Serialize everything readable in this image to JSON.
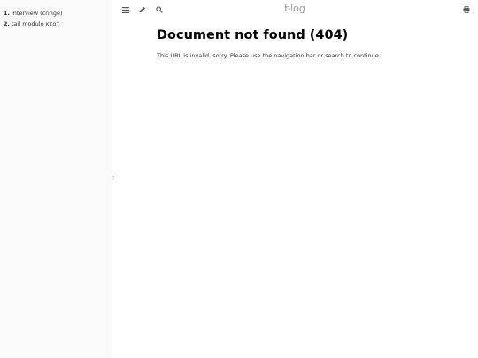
{
  "sidebar": {
    "chapters": [
      {
        "number": "1.",
        "title": "interview (cringe)"
      },
      {
        "number": "2.",
        "title": "tail modulo κτοτ"
      }
    ]
  },
  "menu_bar": {
    "title": "blog",
    "icons": [
      "menu-icon",
      "pencil-icon",
      "search-icon",
      "print-icon"
    ]
  },
  "main": {
    "heading": "Document not found (404)",
    "message": "This URL is invalid, sorry. Please use the navigation bar or search to continue."
  },
  "colors": {
    "sidebar_bg": "#fafafa",
    "title": "#999999",
    "heading": "#000000",
    "text": "#333333"
  }
}
